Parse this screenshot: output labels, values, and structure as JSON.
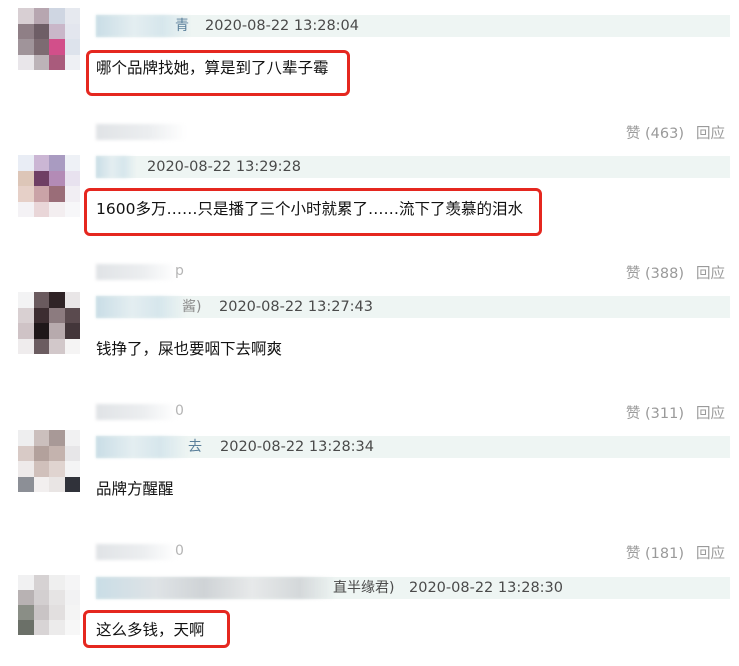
{
  "comments": [
    {
      "name_tail": "青",
      "timestamp": "2020-08-22 13:28:04",
      "text": "哪个品牌找她，算是到了八辈子霉",
      "likes_label": "赞 (463)",
      "reply_label": "回应"
    },
    {
      "name_tail": "",
      "timestamp": "2020-08-22 13:29:28",
      "text": "1600多万……只是播了三个小时就累了……流下了羡慕的泪水",
      "likes_label": "赞 (388)",
      "reply_label": "回应"
    },
    {
      "name_tail": "p",
      "name_tail2": "酱)",
      "timestamp": "2020-08-22 13:27:43",
      "text": "钱挣了，屎也要咽下去啊爽",
      "likes_label": "赞 (311)",
      "reply_label": "回应"
    },
    {
      "name_tail": "0",
      "name_tail2": "去",
      "timestamp": "2020-08-22 13:28:34",
      "text": "品牌方醒醒",
      "likes_label": "赞 (181)",
      "reply_label": "回应"
    },
    {
      "name_tail": "0",
      "name_tail2": "直半缘君)",
      "timestamp": "2020-08-22 13:28:30",
      "text": "这么多钱，天啊"
    }
  ],
  "colors": {
    "highlight_border": "#e5271f",
    "header_bar": "#eef5f3",
    "action_text": "#9a9a9a"
  },
  "icons": [
    "avatar-pixelated"
  ]
}
